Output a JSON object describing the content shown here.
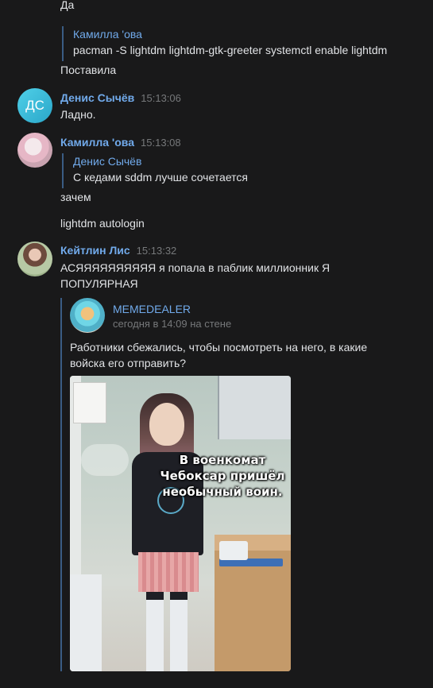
{
  "messages": {
    "m1": {
      "text": "Да"
    },
    "m2": {
      "quote_author": "Камилла 'ова",
      "quote_text": "pacman -S lightdm lightdm-gtk-greeter systemctl enable lightdm",
      "text": "Поставила"
    },
    "m3": {
      "avatar_initials": "ДС",
      "author": "Денис Сычёв",
      "time": "15:13:06",
      "text": "Ладно."
    },
    "m4": {
      "author": "Камилла 'ова",
      "time": "15:13:08",
      "quote_author": "Денис Сычёв",
      "quote_text": "С кедами sddm лучше сочетается",
      "text": "зачем",
      "text2": "lightdm autologin"
    },
    "m5": {
      "author": "Кейтлин Лис",
      "time": "15:13:32",
      "text": "АСЯЯЯЯЯЯЯЯЯЯ я попала в паблик миллионник Я ПОПУЛЯРНАЯ",
      "repost": {
        "author": "MEMEDEALER",
        "meta": "сегодня в 14:09 на стене",
        "text": "Работники сбежались, чтобы посмотреть на него, в какие войска его отправить?",
        "image_caption": "В военкомат Чебоксар пришёл необычный воин."
      }
    }
  },
  "colors": {
    "background": "#19191a",
    "link": "#71aaeb",
    "text": "#e1e3e6",
    "muted": "#76787a",
    "quote_bar": "#3a5c84"
  }
}
